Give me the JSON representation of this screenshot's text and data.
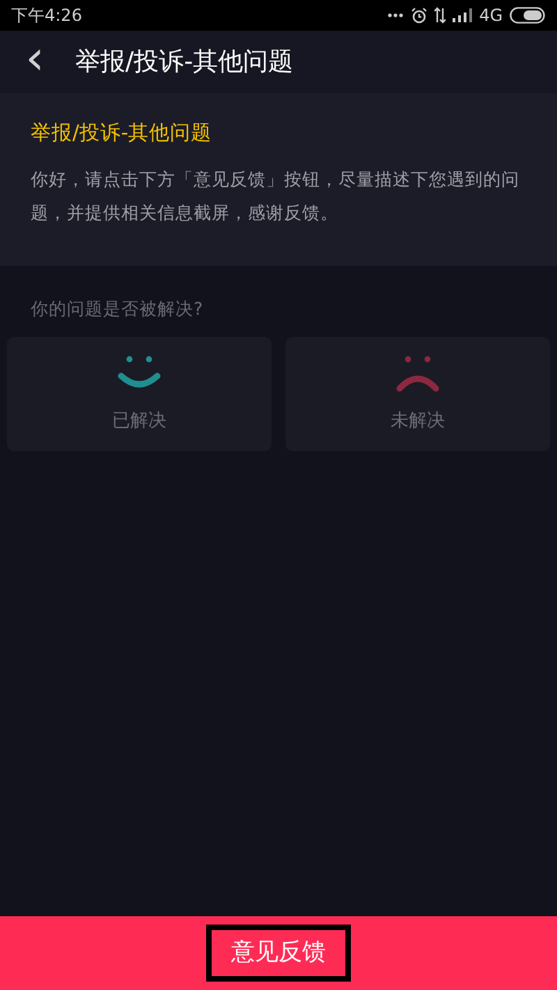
{
  "status_bar": {
    "time": "下午4:26",
    "network": "4G"
  },
  "header": {
    "back": "‹",
    "title": "举报/投诉-其他问题"
  },
  "info": {
    "title": "举报/投诉-其他问题",
    "body": "你好，请点击下方「意见反馈」按钮，尽量描述下您遇到的问题，并提供相关信息截屏，感谢反馈。"
  },
  "question": "你的问题是否被解决?",
  "options": [
    {
      "kind": "happy",
      "label": "已解决",
      "color": "#1f8f8f"
    },
    {
      "kind": "sad",
      "label": "未解决",
      "color": "#8c2840"
    }
  ],
  "feedback_button": {
    "label": "意见反馈",
    "highlighted": true
  }
}
